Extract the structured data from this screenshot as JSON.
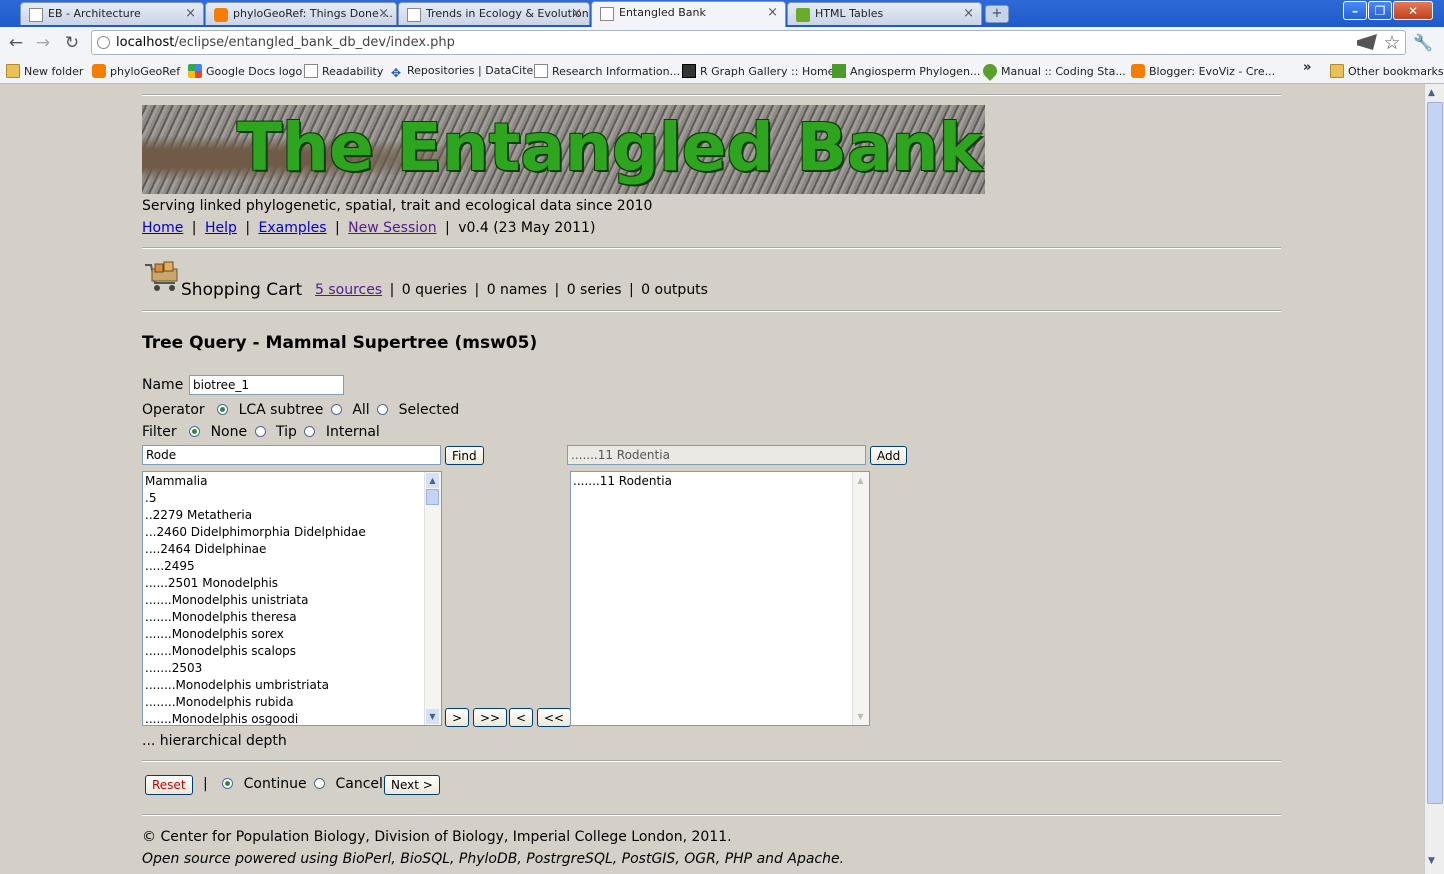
{
  "browser": {
    "tabs": [
      {
        "title": "EB - Architecture",
        "icon": "page-icon",
        "active": false
      },
      {
        "title": "phyloGeoRef: Things Done ...",
        "icon": "blogger-icon",
        "active": false
      },
      {
        "title": "Trends in Ecology & Evolution",
        "icon": "page-icon",
        "active": false
      },
      {
        "title": "Entangled Bank",
        "icon": "page-icon",
        "active": true
      },
      {
        "title": "HTML Tables",
        "icon": "tables-icon",
        "active": false
      }
    ],
    "new_tab": "+",
    "window_controls": {
      "minimize": "–",
      "maximize": "❐",
      "close": "✕"
    },
    "nav": {
      "back": "←",
      "forward": "→",
      "reload": "↻"
    },
    "url_host": "localhost",
    "url_path": "/eclipse/entangled_bank_db_dev/index.php",
    "bookmarks": [
      {
        "label": "New folder",
        "icon": "folder-icon"
      },
      {
        "label": "phyloGeoRef",
        "icon": "blogger-icon"
      },
      {
        "label": "Google Docs logo",
        "icon": "google-icon"
      },
      {
        "label": "Readability",
        "icon": "page-icon"
      },
      {
        "label": "Repositories | DataCite",
        "icon": "datacite-icon"
      },
      {
        "label": "Research Information...",
        "icon": "page-icon"
      },
      {
        "label": "R Graph Gallery :: Home",
        "icon": "rgraph-icon"
      },
      {
        "label": "Angiosperm Phylogen...",
        "icon": "leaf-icon"
      },
      {
        "label": "Manual :: Coding Sta...",
        "icon": "drop-icon"
      },
      {
        "label": "Blogger: EvoViz - Cre...",
        "icon": "blogger-icon"
      }
    ],
    "bookmarks_more": "»",
    "other_bookmarks": "Other bookmarks"
  },
  "header": {
    "banner_title": "The Entangled Bank",
    "tagline": "Serving linked phylogenetic, spatial, trait and ecological data since 2010",
    "nav": {
      "home": "Home",
      "help": "Help",
      "examples": "Examples",
      "new_session": "New Session",
      "sep": "|"
    },
    "version": "v0.4 (23 May 2011)"
  },
  "cart": {
    "title": "Shopping Cart",
    "sources": "5 sources",
    "queries": "0 queries",
    "names": "0 names",
    "series": "0 series",
    "outputs": "0 outputs",
    "sep": "|"
  },
  "query": {
    "heading": "Tree Query - Mammal Supertree (msw05)",
    "name_label": "Name",
    "name_value": "biotree_1",
    "operator_label": "Operator",
    "operator_options": [
      "LCA subtree",
      "All",
      "Selected"
    ],
    "operator_selected": 0,
    "filter_label": "Filter",
    "filter_options": [
      "None",
      "Tip",
      "Internal"
    ],
    "filter_selected": 0,
    "search_value": "Rode",
    "find_label": "Find",
    "selected_value": ".......11 Rodentia",
    "add_label": "Add",
    "tree_items": [
      "Mammalia",
      ".5",
      "..2279 Metatheria",
      "...2460 Didelphimorphia Didelphidae",
      "....2464 Didelphinae",
      ".....2495",
      "......2501 Monodelphis",
      ".......Monodelphis unistriata",
      ".......Monodelphis theresa",
      ".......Monodelphis sorex",
      ".......Monodelphis scalops",
      ".......2503",
      "........Monodelphis umbristriata",
      "........Monodelphis rubida",
      ".......Monodelphis osgoodi"
    ],
    "selected_items": [
      ".......11 Rodentia"
    ],
    "move_buttons": [
      ">",
      ">>",
      "<",
      "<<"
    ],
    "depth_note": "... hierarchical depth"
  },
  "actions": {
    "reset": "Reset",
    "sep": "|",
    "options": [
      "Continue",
      "Cancel"
    ],
    "selected": 0,
    "next": "Next >"
  },
  "footer": {
    "copyright": "© Center for Population Biology, Division of Biology, Imperial College London, 2011.",
    "powered": "Open source powered using BioPerl, BioSQL, PhyloDB, PostrgreSQL, PostGIS, OGR, PHP and Apache."
  }
}
